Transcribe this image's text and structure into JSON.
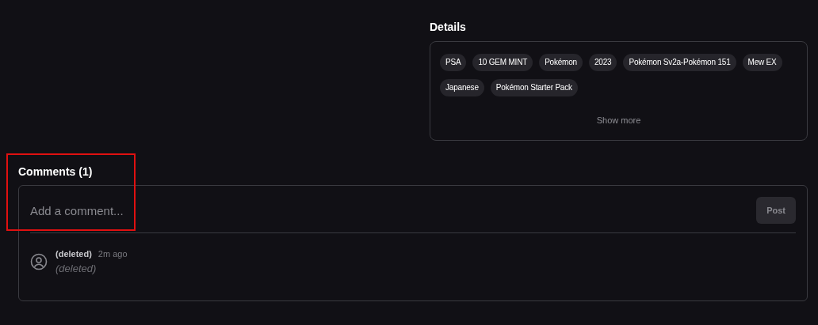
{
  "details": {
    "title": "Details",
    "tags": [
      "PSA",
      "10 GEM MINT",
      "Pokémon",
      "2023",
      "Pokémon Sv2a-Pokémon 151",
      "Mew EX",
      "Japanese",
      "Pokémon Starter Pack"
    ],
    "show_more": "Show more"
  },
  "comments": {
    "title": "Comments (1)",
    "input": {
      "placeholder": "Add a comment..."
    },
    "post_button": {
      "label": "Post",
      "disabled": true
    },
    "items": [
      {
        "author": "(deleted)",
        "time": "2m ago",
        "text": "(deleted)"
      }
    ]
  },
  "highlight_box": {
    "visible": true
  }
}
